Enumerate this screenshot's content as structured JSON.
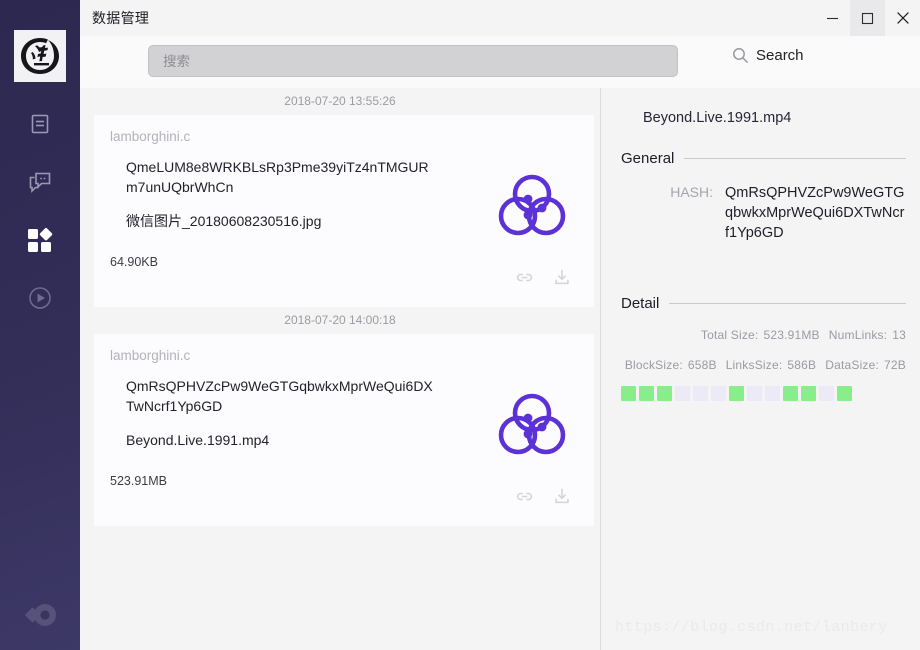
{
  "window": {
    "title": "数据管理",
    "minimize_label": "minimize",
    "maximize_label": "maximize",
    "close_label": "close"
  },
  "sidebar": {
    "brand_name": "ink-brush-logo",
    "items": [
      {
        "name": "document-icon",
        "label": "Document"
      },
      {
        "name": "chat-icon",
        "label": "Chat"
      },
      {
        "name": "apps-grid-icon",
        "label": "Apps",
        "active": true
      },
      {
        "name": "play-circle-icon",
        "label": "Play"
      }
    ],
    "footer_icon": "ipfs-logo-icon"
  },
  "search": {
    "placeholder": "搜索",
    "value": "",
    "button_label": "Search",
    "button_icon": "search-icon"
  },
  "list": [
    {
      "timestamp": "2018-07-20 13:55:26",
      "owner": "lamborghini.c",
      "hash": "QmeLUM8e8WRKBLsRp3Pme39yiTz4nTMGURm7unUQbrWhCn",
      "filename": "微信图片_20180608230516.jpg",
      "size": "64.90KB",
      "logo_icon": "ipfs-trefoil-icon",
      "actions": [
        {
          "name": "copy-link-icon",
          "label": "Copy link"
        },
        {
          "name": "download-icon",
          "label": "Download"
        }
      ]
    },
    {
      "timestamp": "2018-07-20 14:00:18",
      "owner": "lamborghini.c",
      "hash": "QmRsQPHVZcPw9WeGTGqbwkxMprWeQui6DXTwNcrf1Yp6GD",
      "filename": "Beyond.Live.1991.mp4",
      "size": "523.91MB",
      "logo_icon": "ipfs-trefoil-icon",
      "actions": [
        {
          "name": "copy-link-icon",
          "label": "Copy link"
        },
        {
          "name": "download-icon",
          "label": "Download"
        }
      ]
    }
  ],
  "detail": {
    "title": "Beyond.Live.1991.mp4",
    "general_label": "General",
    "hash_key": "HASH:",
    "hash_value": "QmRsQPHVZcPw9WeGTGqbwkxMprWeQui6DXTwNcrf1Yp6GD",
    "detail_label": "Detail",
    "total_size_key": "Total Size:",
    "total_size_value": "523.91MB",
    "numlinks_key": "NumLinks:",
    "numlinks_value": "13",
    "blocksize_key": "BlockSize:",
    "blocksize_value": "658B",
    "linkssize_key": "LinksSize:",
    "linkssize_value": "586B",
    "datasize_key": "DataSize:",
    "datasize_value": "72B",
    "blocks": [
      1,
      1,
      1,
      0,
      0,
      0,
      1,
      0,
      0,
      1,
      1,
      0,
      1
    ]
  },
  "watermark": "https://blog.csdn.net/lanbery",
  "colors": {
    "sidebar_top": "#2c2850",
    "sidebar_bottom": "#3d3866",
    "accent_purple": "#5c31d6",
    "block_on": "#87ee8a",
    "block_off": "#eceaf7",
    "page_bg": "#f4f4f5",
    "card_bg": "#fcfcfe"
  }
}
